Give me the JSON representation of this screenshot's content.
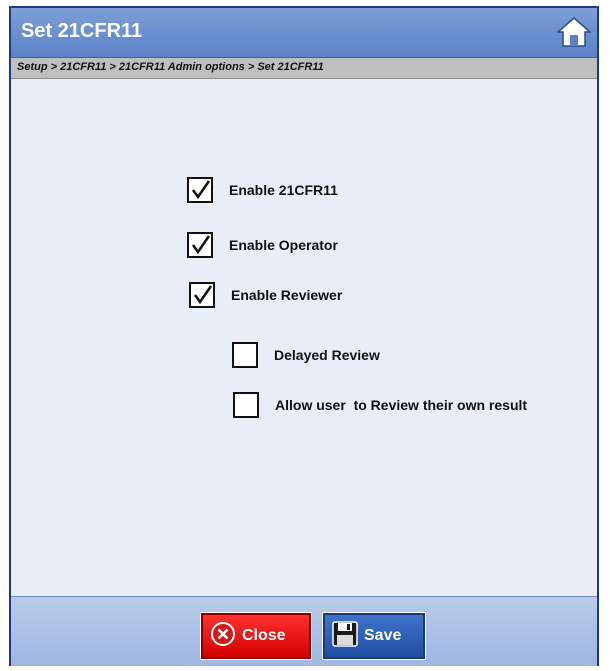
{
  "window": {
    "title": "Set 21CFR11",
    "breadcrumb": "Setup > 21CFR11 > 21CFR11 Admin options > Set 21CFR11"
  },
  "options": [
    {
      "label": "Enable 21CFR11",
      "checked": true
    },
    {
      "label": "Enable Operator",
      "checked": true
    },
    {
      "label": "Enable Reviewer",
      "checked": true
    },
    {
      "label": "Delayed Review",
      "checked": false
    },
    {
      "label": "Allow user  to Review their own result",
      "checked": false
    }
  ],
  "footer": {
    "close_label": "Close",
    "save_label": "Save"
  },
  "icons": {
    "home": "home-icon",
    "close": "close-circle-icon",
    "save": "floppy-disk-icon",
    "check": "checkmark-icon"
  },
  "colors": {
    "titlebar": "#5b82c8",
    "close_button": "#e00000",
    "save_button": "#2a5db3"
  }
}
